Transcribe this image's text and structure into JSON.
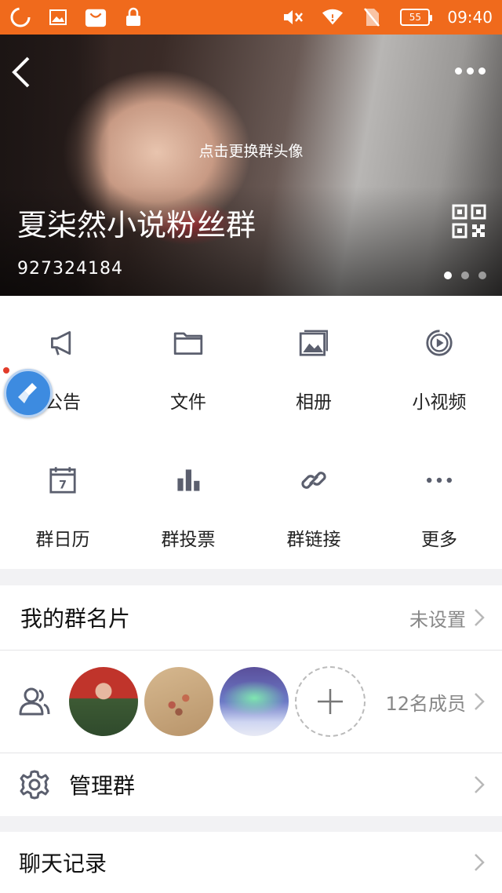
{
  "status_bar": {
    "battery": "55",
    "time": "09:40",
    "icons": [
      "loading-icon",
      "image-icon",
      "shopping-bag-icon",
      "lock-icon",
      "mute-icon",
      "wifi-icon",
      "no-sim-icon",
      "battery-icon"
    ]
  },
  "hero": {
    "change_avatar_hint": "点击更换群头像",
    "group_name": "夏柒然小说粉丝群",
    "group_id": "927324184",
    "page_dots": 3,
    "active_dot": 1
  },
  "features": [
    {
      "label": "公告",
      "icon": "megaphone-icon"
    },
    {
      "label": "文件",
      "icon": "folder-icon"
    },
    {
      "label": "相册",
      "icon": "album-icon"
    },
    {
      "label": "小视频",
      "icon": "video-icon"
    },
    {
      "label": "群日历",
      "icon": "calendar-icon"
    },
    {
      "label": "群投票",
      "icon": "bar-chart-icon"
    },
    {
      "label": "群链接",
      "icon": "link-icon"
    },
    {
      "label": "更多",
      "icon": "more-icon"
    }
  ],
  "card": {
    "title": "我的群名片",
    "value": "未设置"
  },
  "members": {
    "count_label": "12名成员"
  },
  "manage": {
    "title": "管理群"
  },
  "chat_history": {
    "title": "聊天记录"
  },
  "colors": {
    "status_bar": "#f06a1c",
    "icon_gray": "#5b5f6e",
    "float_ball": "#3d8be0"
  }
}
